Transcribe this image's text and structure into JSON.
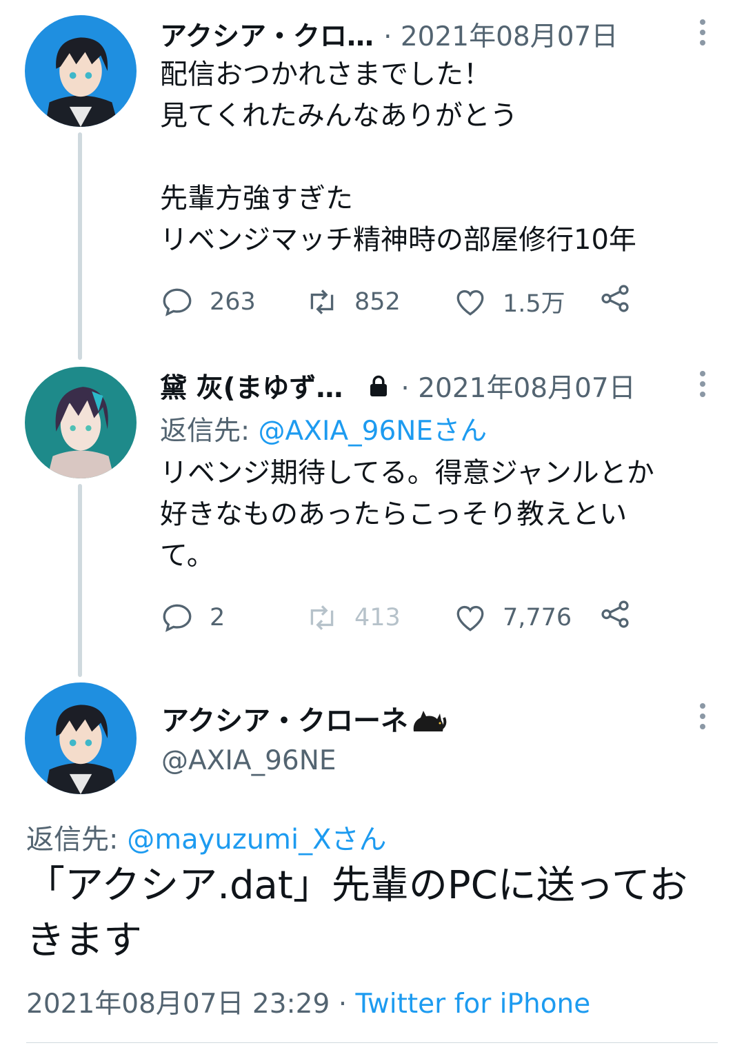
{
  "tweets": [
    {
      "name": "アクシア・クロ…",
      "date": "· 2021年08月07日",
      "text": "配信おつかれさまでした！\n見てくれたみんなありがとう\n\n先輩方強すぎた\nリベンジマッチ精神時の部屋修行10年",
      "replies": "263",
      "retweets": "852",
      "likes": "1.5万",
      "avatar_color": "#1f8fe0"
    },
    {
      "name": "黛 灰(まゆず…",
      "date": "· 2021年08月07日",
      "reply_prefix": "返信先: ",
      "reply_handle": "@AXIA_96NEさん",
      "text": "リベンジ期待してる。得意ジャンルとか\n好きなものあったらこっそり教えとい\nて。",
      "replies": "2",
      "retweets": "413",
      "likes": "7,776",
      "avatar_color": "#1e8a8a"
    }
  ],
  "main_tweet": {
    "name": "アクシア・クローネ",
    "name_emoji": "🐈‍⬛",
    "handle": "@AXIA_96NE",
    "reply_prefix": "返信先: ",
    "reply_handle": "@mayuzumi_Xさん",
    "text": "「アクシア.dat」先輩のPCに送っておきます",
    "timestamp": "2021年08月07日 23:29",
    "separator": " · ",
    "source": "Twitter for iPhone",
    "avatar_color": "#1f8fe0"
  },
  "colors": {
    "accent": "#1d9bf0",
    "secondary_text": "#536471",
    "thread_line": "#cfd9de"
  }
}
